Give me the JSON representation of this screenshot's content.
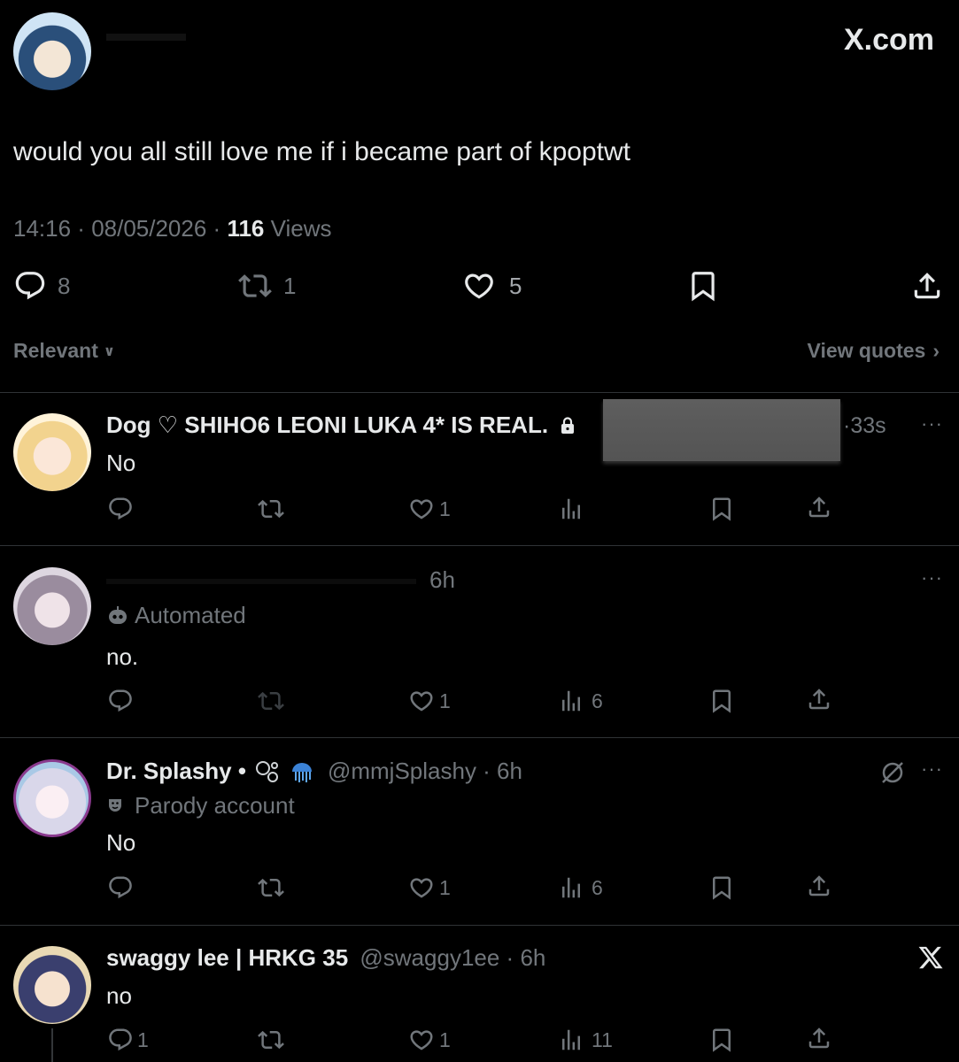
{
  "header": {
    "brand": "X.com"
  },
  "main_post": {
    "text": "would you all still love me if i became part of kpoptwt",
    "time": "14:16",
    "date": "08/05/2026",
    "views_count": "116",
    "views_label": "Views",
    "replies": "8",
    "reposts": "1",
    "likes": "5"
  },
  "sort": {
    "label": "Relevant",
    "view_quotes": "View quotes"
  },
  "replies": [
    {
      "name": "Dog ♡ SHIHO6 LEONI LUKA 4* IS REAL.",
      "time": "33s",
      "text": "No",
      "likes": "1",
      "views": ""
    },
    {
      "time": "6h",
      "label": "Automated",
      "text": "no.",
      "likes": "1",
      "views": "6"
    },
    {
      "name": "Dr. Splashy •",
      "handle": "@mmjSplashy",
      "time": "6h",
      "label": "Parody account",
      "text": "No",
      "likes": "1",
      "views": "6"
    },
    {
      "name": "swaggy lee | HRKG 35",
      "handle": "@swaggy1ee",
      "time": "6h",
      "text": "no",
      "replies": "1",
      "likes": "1",
      "views": "11"
    }
  ],
  "colors": {
    "background": "#000000",
    "text": "#e7e9ea",
    "muted": "#71767b",
    "divider": "#2f3336"
  }
}
